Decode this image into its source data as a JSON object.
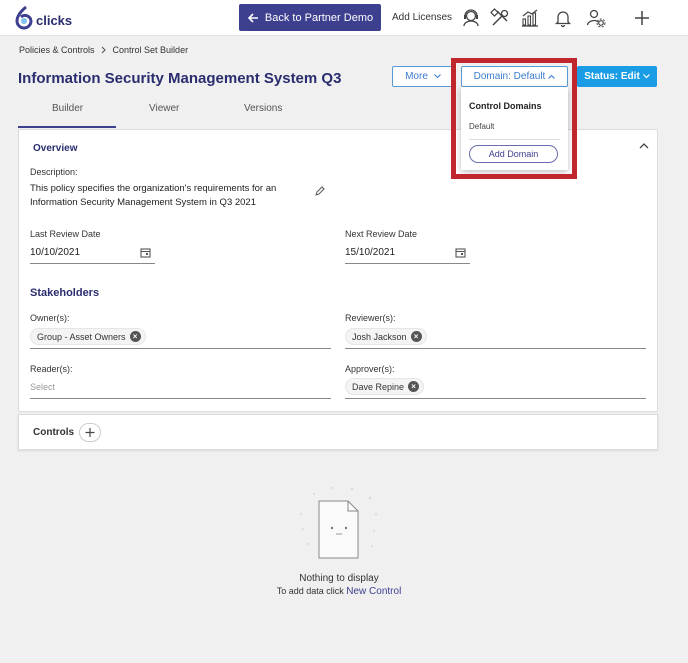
{
  "topbar": {
    "logo_text": "clicks",
    "back_label": "Back to Partner Demo",
    "add_licenses": "Add Licenses",
    "icons": [
      "support-agent-icon",
      "tools-icon",
      "analytics-icon",
      "bell-icon",
      "user-settings-icon",
      "plus-icon"
    ]
  },
  "breadcrumb": {
    "items": [
      "Policies & Controls",
      "Control Set Builder"
    ]
  },
  "page": {
    "title": "Information Security Management System Q3"
  },
  "actions": {
    "more": "More",
    "domain": "Domain: Default",
    "status": "Status: Edit"
  },
  "tabs": [
    "Builder",
    "Viewer",
    "Versions"
  ],
  "overview": {
    "title": "Overview",
    "description_label": "Description:",
    "description_line1": "This policy specifies the organization's requirements for an",
    "description_line2": "Information Security Management System in Q3 2021",
    "last_review_label": "Last Review Date",
    "last_review_value": "10/10/2021",
    "next_review_label": "Next Review Date",
    "next_review_value": "15/10/2021"
  },
  "stakeholders": {
    "title": "Stakeholders",
    "owners_label": "Owner(s):",
    "owners": [
      "Group - Asset Owners"
    ],
    "reviewers_label": "Reviewer(s):",
    "reviewers": [
      "Josh Jackson"
    ],
    "readers_label": "Reader(s):",
    "readers_placeholder": "Select",
    "approvers_label": "Approver(s):",
    "approvers": [
      "Dave Repine"
    ]
  },
  "controls": {
    "title": "Controls"
  },
  "domain_dropdown": {
    "heading": "Control Domains",
    "items": [
      "Default"
    ],
    "add_label": "Add Domain"
  },
  "empty_state": {
    "title": "Nothing to display",
    "hint": "To add data click",
    "link": "New Control"
  },
  "colors": {
    "brand": "#3d3f8f",
    "accent": "#1a9de4",
    "highlight": "#c0272d"
  }
}
